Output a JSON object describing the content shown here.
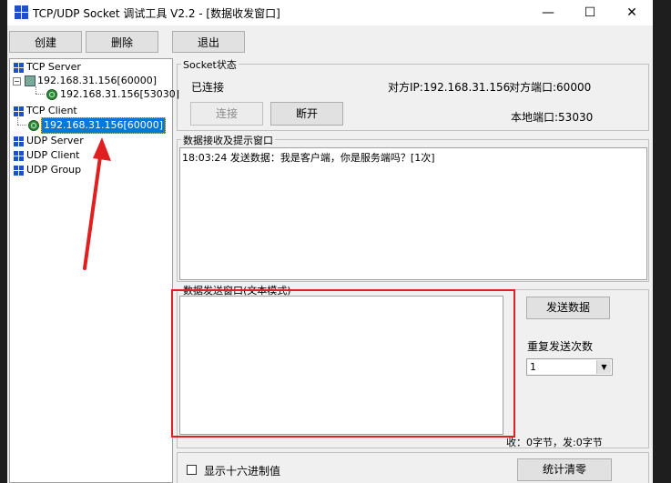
{
  "window": {
    "title": "TCP/UDP Socket 调试工具 V2.2 - [数据收发窗口]",
    "minimize": "—",
    "maximize": "☐",
    "close": "✕"
  },
  "toolbar": {
    "create": "创建",
    "delete": "删除",
    "exit": "退出"
  },
  "tree": {
    "tcp_server": "TCP Server",
    "tcp_server_node": "192.168.31.156[60000]",
    "tcp_server_child": "192.168.31.156[53030]",
    "tcp_client": "TCP Client",
    "tcp_client_node": "192.168.31.156[60000]",
    "udp_server": "UDP Server",
    "udp_client": "UDP Client",
    "udp_group": "UDP Group"
  },
  "socket_status": {
    "label": "Socket状态",
    "connected": "已连接",
    "remote_ip": "对方IP:192.168.31.156",
    "remote_port": "对方端口:60000",
    "local_port": "本地端口:53030",
    "connect_button": "连接",
    "disconnect_button": "断开"
  },
  "receive": {
    "label": "数据接收及提示窗口",
    "line1": "18:03:24 发送数据：我是客户端，你是服务端吗？[1次]"
  },
  "send": {
    "label": "数据发送窗口(文本模式)",
    "send_button": "发送数据",
    "repeat_label": "重复发送次数",
    "repeat_value": "1",
    "stats": "收：0字节，发:0字节"
  },
  "bottom": {
    "hex_checkbox": "显示十六进制值",
    "clear_stats": "统计清零"
  },
  "colors": {
    "annotation_red": "#e02020",
    "selection_blue": "#0078d7"
  }
}
